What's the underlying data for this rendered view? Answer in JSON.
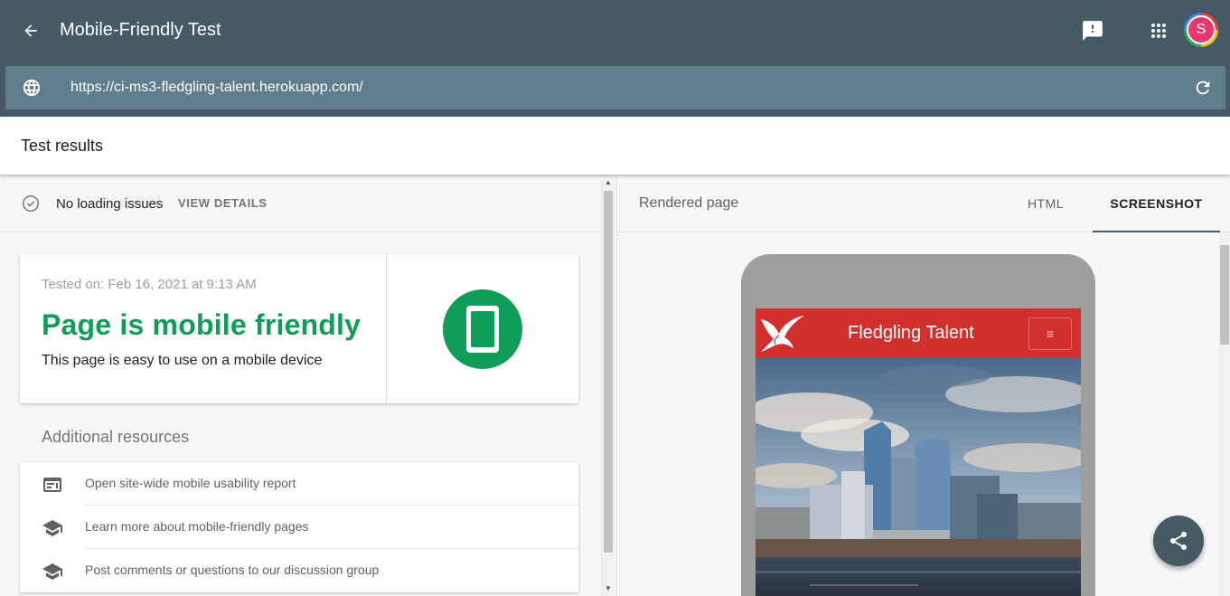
{
  "header": {
    "title": "Mobile-Friendly Test",
    "url": "https://ci-ms3-fledgling-talent.herokuapp.com/",
    "avatar_letter": "S",
    "icons": [
      "back-arrow-icon",
      "feedback-icon",
      "apps-grid-icon",
      "globe-icon",
      "reload-icon"
    ]
  },
  "results": {
    "title": "Test results",
    "status_text": "No loading issues",
    "view_details": "VIEW DETAILS",
    "tested_on": "Tested on: Feb 16, 2021 at 9:13 AM",
    "verdict": "Page is mobile friendly",
    "verdict_sub": "This page is easy to use on a mobile device",
    "verdict_color": "#0f9d58"
  },
  "resources": {
    "title": "Additional resources",
    "items": [
      {
        "label": "Open site-wide mobile usability report",
        "icon": "report-icon"
      },
      {
        "label": "Learn more about mobile-friendly pages",
        "icon": "school-icon"
      },
      {
        "label": "Post comments or questions to our discussion group",
        "icon": "school-icon"
      }
    ]
  },
  "preview": {
    "label": "Rendered page",
    "tabs": [
      {
        "label": "HTML",
        "active": false
      },
      {
        "label": "SCREENSHOT",
        "active": true
      }
    ],
    "site_title": "Fledgling Talent",
    "site_menu": "≡",
    "site_header_color": "#d32f2f"
  },
  "colors": {
    "header_bg": "#455a64",
    "urlbar_bg": "#607d8b",
    "accent_green": "#0f9d58"
  }
}
